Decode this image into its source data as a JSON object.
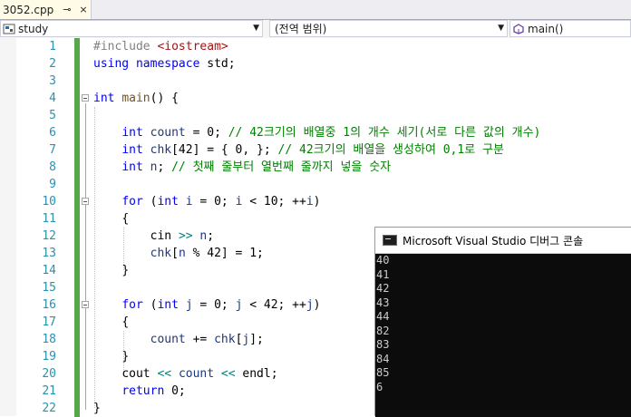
{
  "tab": {
    "filename": "3052.cpp",
    "pin": "⊸",
    "close": "×"
  },
  "navbar": {
    "project": "study",
    "scope": "(전역 범위)",
    "member": "main()"
  },
  "editor": {
    "lines": [
      {
        "n": "1"
      },
      {
        "n": "2"
      },
      {
        "n": "3"
      },
      {
        "n": "4"
      },
      {
        "n": "5"
      },
      {
        "n": "6"
      },
      {
        "n": "7"
      },
      {
        "n": "8"
      },
      {
        "n": "9"
      },
      {
        "n": "10"
      },
      {
        "n": "11"
      },
      {
        "n": "12"
      },
      {
        "n": "13"
      },
      {
        "n": "14"
      },
      {
        "n": "15"
      },
      {
        "n": "16"
      },
      {
        "n": "17"
      },
      {
        "n": "18"
      },
      {
        "n": "19"
      },
      {
        "n": "20"
      },
      {
        "n": "21"
      },
      {
        "n": "22"
      }
    ],
    "code": {
      "l1_pp": "#include",
      "l1_hdr": "<iostream>",
      "l2_kw1": "using",
      "l2_kw2": "namespace",
      "l2_rest": " std;",
      "l4_kw": "int",
      "l4_fn": "main",
      "l4_rest": "() {",
      "l6_kw": "int",
      "l6_var": "count",
      "l6_mid": " = 0; ",
      "l6_cm": "// 42크기의 배열중 1의 개수 세기(서로 다른 값의 개수)",
      "l7_kw": "int",
      "l7_var": "chk",
      "l7_mid": "[42] = { 0, }; ",
      "l7_cm": "// 42크기의 배열을 생성하여 0,1로 구분",
      "l8_kw": "int",
      "l8_var": "n",
      "l8_mid": "; ",
      "l8_cm": "// 첫째 줄부터 열번째 줄까지 넣을 숫자",
      "l10_kw1": "for",
      "l10_a": " (",
      "l10_kw2": "int",
      "l10_var1": "i",
      "l10_b": " = 0; ",
      "l10_var2": "i",
      "l10_c": " < 10; ++",
      "l10_var3": "i",
      "l10_d": ")",
      "l11": "{",
      "l12_a": "cin",
      "l12_op": ">>",
      "l12_var": "n",
      "l12_b": ";",
      "l13_var1": "chk",
      "l13_a": "[",
      "l13_var2": "n",
      "l13_b": " % 42] = 1;",
      "l14": "}",
      "l16_kw1": "for",
      "l16_a": " (",
      "l16_kw2": "int",
      "l16_var1": "j",
      "l16_b": " = 0; ",
      "l16_var2": "j",
      "l16_c": " < 42; ++",
      "l16_var3": "j",
      "l16_d": ")",
      "l17": "{",
      "l18_var1": "count",
      "l18_a": " += ",
      "l18_var2": "chk",
      "l18_b": "[",
      "l18_var3": "j",
      "l18_c": "];",
      "l19": "}",
      "l20_a": "cout",
      "l20_op1": "<<",
      "l20_var": "count",
      "l20_op2": "<<",
      "l20_b": "endl",
      "l20_c": ";",
      "l21_kw": "return",
      "l21_rest": " 0;",
      "l22": "}"
    }
  },
  "console": {
    "title": "Microsoft Visual Studio 디버그 콘솔",
    "output": [
      "40",
      "41",
      "42",
      "43",
      "44",
      "82",
      "83",
      "84",
      "85",
      "6"
    ]
  },
  "colors": {
    "keyword": "#0000ff",
    "comment": "#008000",
    "string": "#a31515",
    "line_number": "#2b91af",
    "change_bar": "#57a64a"
  }
}
